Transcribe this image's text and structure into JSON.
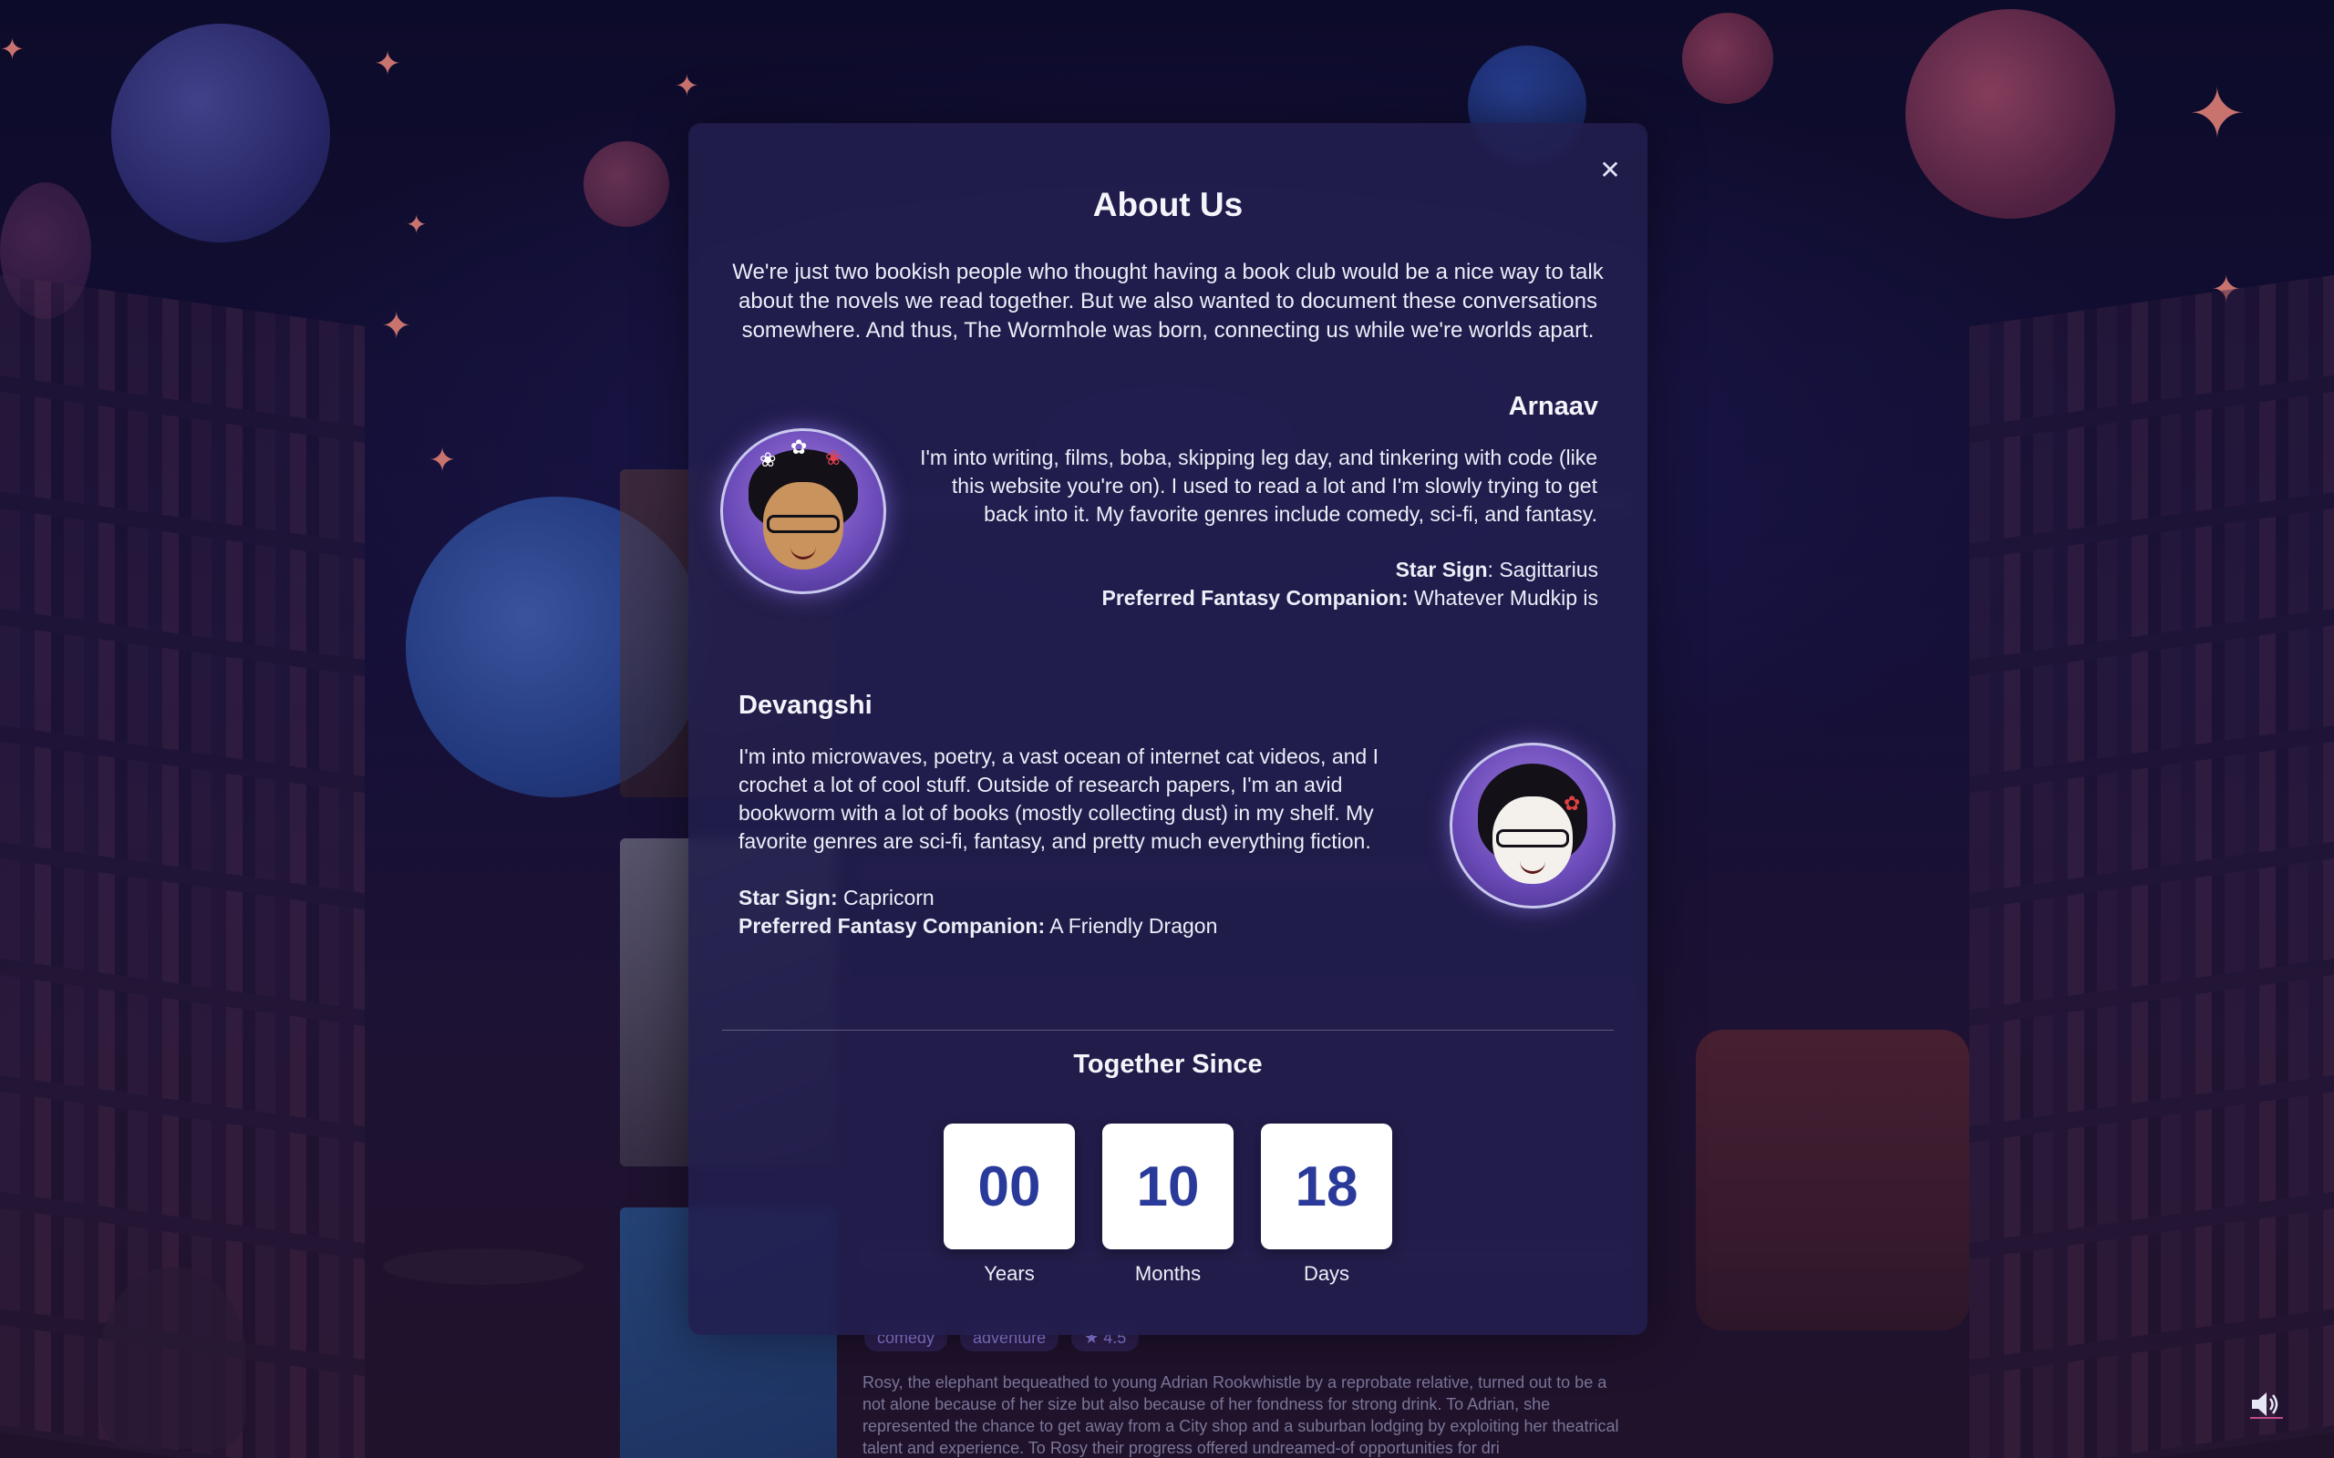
{
  "modal": {
    "title": "About Us",
    "close_icon": "close-icon",
    "intro": "We're just two bookish people who thought having a book club would be a nice way to talk about the novels we read together. But we also wanted to document these conversations somewhere. And thus, The Wormhole was born, connecting us while we're worlds apart."
  },
  "members": [
    {
      "name": "Arnaav",
      "bio": "I'm into writing, films, boba, skipping leg day, and tinkering with code (like this website you're on). I used to read a lot and I'm slowly trying to get back into it. My favorite genres include comedy, sci-fi, and fantasy.",
      "star_sign_label": "Star Sign",
      "star_sign_sep": ": ",
      "star_sign": "Sagittarius",
      "companion_label": "Preferred Fantasy Companion:",
      "companion": "Whatever Mudkip is"
    },
    {
      "name": "Devangshi",
      "bio": "I'm into microwaves, poetry, a vast ocean of internet cat videos, and I crochet a lot of cool stuff. Outside of research papers, I'm an avid bookworm with a lot of books (mostly collecting dust) in my shelf. My favorite genres are sci-fi, fantasy, and pretty much everything fiction.",
      "star_sign_label": "Star Sign:",
      "star_sign": "Capricorn",
      "companion_label": "Preferred Fantasy Companion:",
      "companion": "A Friendly Dragon"
    }
  ],
  "together": {
    "title": "Together Since",
    "years": "00",
    "months": "10",
    "days": "18",
    "years_label": "Years",
    "months_label": "Months",
    "days_label": "Days"
  },
  "background": {
    "tags": [
      "comedy",
      "adventure",
      "★ 4.5"
    ],
    "book_text": "Rosy, the elephant bequeathed to young Adrian Rookwhistle by a reprobate relative, turned out to be a not alone because of her size but also because of her fondness for strong drink. To Adrian, she represented the chance to get away from a City shop and a suburban lodging by exploiting her theatrical talent and experience. To Rosy their progress offered undreamed-of opportunities for dri"
  },
  "colors": {
    "modal_bg": "#221e4e",
    "count_text": "#2a3a9a",
    "accent_glow": "#9678ff"
  },
  "icons": {
    "sound": "speaker-icon"
  }
}
